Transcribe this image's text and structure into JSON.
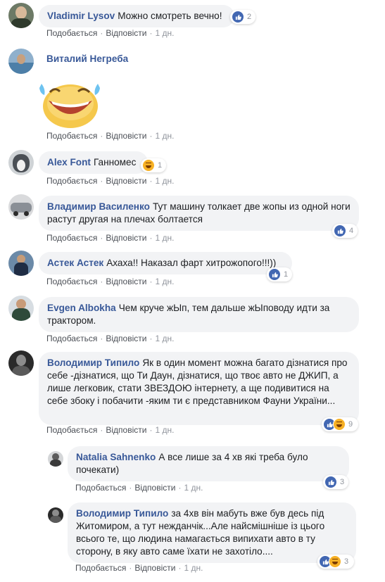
{
  "actions": {
    "like": "Подобається",
    "reply": "Відповісти",
    "sep": "·"
  },
  "comments": [
    {
      "name": "Vladimir Lysov",
      "text": "Можно смотреть вечно!",
      "time": "1 дн.",
      "reactions": "2",
      "react_types": [
        "like"
      ]
    },
    {
      "name": "Виталий Негреба",
      "text": "",
      "time": "1 дн.",
      "sticker": "laughing-face-sticker"
    },
    {
      "name": "Alex Font",
      "text": "Ганномес",
      "time": "1 дн.",
      "reactions": "1",
      "react_types": [
        "haha"
      ]
    },
    {
      "name": "Владимир Василенко",
      "text": "Тут машину толкает две жопы из одной ноги растут другая на плечах болтается",
      "time": "1 дн.",
      "reactions": "4",
      "react_types": [
        "like"
      ]
    },
    {
      "name": "Астек Астек",
      "text": "Ахаха!! Наказал фарт хитрожопого!!!))",
      "time": "1 дн.",
      "reactions": "1",
      "react_types": [
        "like"
      ]
    },
    {
      "name": "Evgen Albokha",
      "text": "Чем круче жЫп, тем дальше жЫповоду идти за трактором.",
      "time": "1 дн."
    },
    {
      "name": "Володимир Типило",
      "text": "Як в один момент можна багато дізнатися про себе -дізнатися, що Ти Даун, дізнатися, що твоє авто не ДЖИП, а лише легковик, стати ЗВЕЗДОЮ інтернету, а ще подивитися на себе збоку і побачити -яким ти є представником Фауни України...",
      "time": "1 дн.",
      "reactions": "9",
      "react_types": [
        "like",
        "haha"
      ]
    },
    {
      "name": "Natalia Sahnenko",
      "text": "А все лише за 4 хв які треба було почекати)",
      "time": "1 дн.",
      "reactions": "3",
      "react_types": [
        "like"
      ]
    },
    {
      "name": "Володимир Типило",
      "text": "за 4хв він мабуть вже був десь під Житомиром, а тут нежданчік...Але найсмішніше із цього всього те, що людина намагається випихати авто в ту сторону, в яку авто саме їхати не захотіло....",
      "time": "1 дн.",
      "reactions": "3",
      "react_types": [
        "like",
        "haha"
      ]
    }
  ],
  "colors": {
    "name": "#385898",
    "bubble": "#f2f3f5",
    "like": "#4267b2",
    "haha": "#f7b125",
    "meta": "#90949c"
  }
}
